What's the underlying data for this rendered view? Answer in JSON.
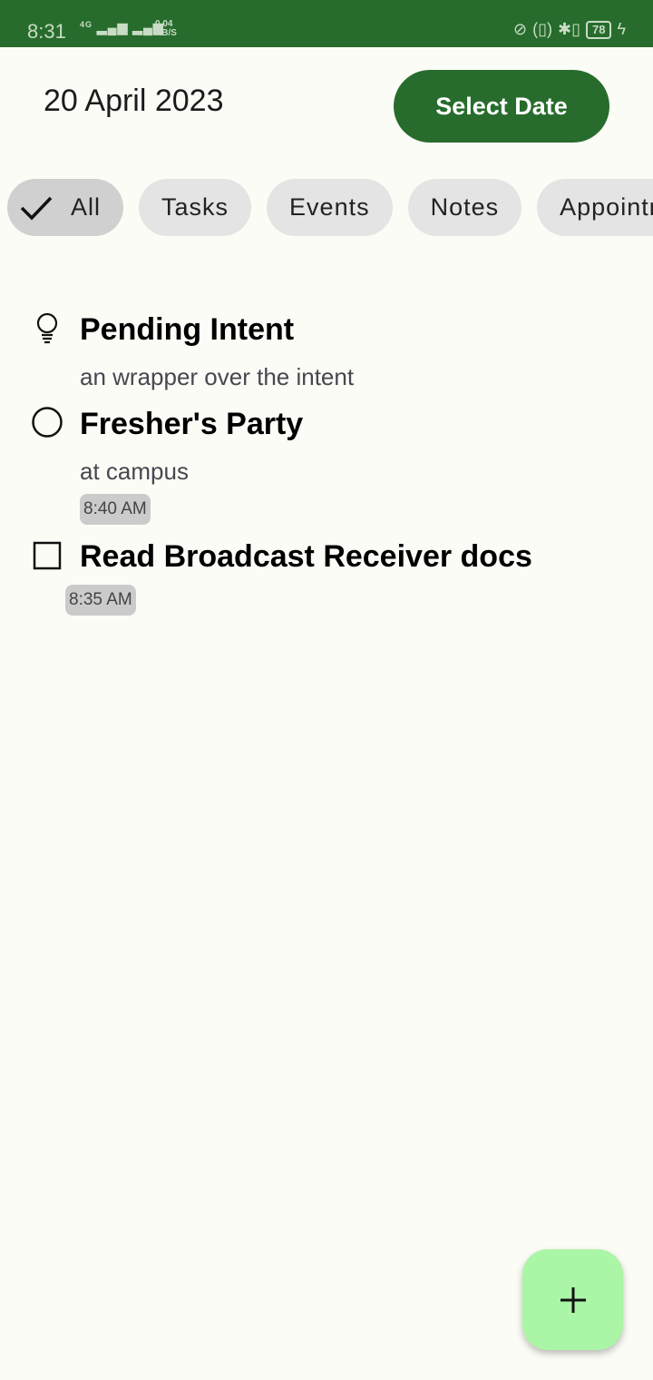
{
  "status_bar": {
    "time": "8:31",
    "network": "4G",
    "speed_value": "0.04",
    "speed_unit": "KB/S",
    "battery": "78"
  },
  "header": {
    "date": "20 April 2023",
    "select_date_label": "Select Date"
  },
  "filters": [
    {
      "label": "All",
      "selected": true
    },
    {
      "label": "Tasks"
    },
    {
      "label": "Events"
    },
    {
      "label": "Notes"
    },
    {
      "label": "Appointments"
    }
  ],
  "items": [
    {
      "type": "note",
      "icon": "lightbulb-icon",
      "title": "Pending Intent",
      "subtitle": "an wrapper over the intent"
    },
    {
      "type": "event",
      "icon": "circle-icon",
      "title": "Fresher's Party",
      "subtitle": "at campus",
      "time": "8:40 AM"
    },
    {
      "type": "task",
      "icon": "checkbox-icon",
      "title": "Read Broadcast Receiver docs",
      "time": "8:35 AM"
    }
  ],
  "colors": {
    "primary": "#276c2c",
    "fab": "#abf5a6",
    "background": "#fbfcf6"
  }
}
